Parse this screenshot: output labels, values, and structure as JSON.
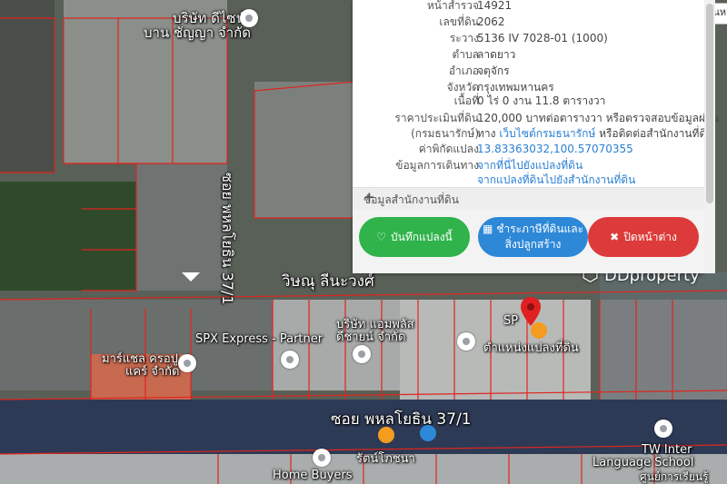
{
  "map": {
    "labels": {
      "company_top": "บริษัท ดีไซน์",
      "company_top2": "บาน ชัญญา จำกัด",
      "soi_vertical": "ซอย พหลโยธิน 37/1",
      "road_name": "วิษณุ ลีนะวงศ์",
      "spx": "SPX Express - Partner",
      "company_mid1": "บริษัท แอมพลัส",
      "company_mid2": "ดีชายน์ จำกัด",
      "marshall1": "มาร์แชล ครอปู",
      "marshall2": "แคร์ จำกัด",
      "sp": "SP",
      "near_pin": "ตำแหน่งแปลงที่ดิน",
      "soi_horizontal": "ซอย พหลโยธิน 37/1",
      "tw1": "TW Inter",
      "tw2": "Language School",
      "tw3": "ศูนย์การเรียนรู้",
      "home_buyers": "Home Buyers",
      "restaurant": "รัตน์โภชนา",
      "watermark": "DDproperty",
      "top_right_partial": "ศูนย์กา"
    }
  },
  "dropdown": {
    "value": "ค้นห"
  },
  "panel": {
    "rows": [
      {
        "key": "หน้าสำรวจ",
        "value": "14921"
      },
      {
        "key": "เลขที่ดิน",
        "value": "2062"
      },
      {
        "key": "ระวาง",
        "value": "5136 IV 7028-01 (1000)"
      },
      {
        "key": "ตำบล",
        "value": "ลาดยาว"
      },
      {
        "key": "อำเภอ",
        "value": "จตุจักร"
      },
      {
        "key": "จังหวัด",
        "value": "กรุงเทพมหานคร"
      },
      {
        "key": "เนื้อที่",
        "value": "0 ไร่ 0 งาน 11.8 ตารางวา"
      },
      {
        "key": "ราคาประเมินที่ดิน",
        "value": "120,000 บาทต่อตารางวา หรือตรวจสอบข้อมูลผ่าน"
      },
      {
        "key": "(กรมธนารักษ์)",
        "value_pre": "ทาง ",
        "value_link": "เว็บไซต์กรมธนารักษ์",
        "value_post": " หรือติดต่อสำนักงานที่ดิน"
      },
      {
        "key": "ค่าพิกัดแปลง",
        "value": "13.83363032,100.57070355"
      },
      {
        "key": "ข้อมูลการเดินทาง",
        "value": "จากที่นี่ไปยังแปลงที่ดิน"
      },
      {
        "key": "",
        "value": "จากแปลงที่ดินไปยังสำนักงานที่ดิน"
      }
    ],
    "office_label": "ข้อมูลสำนักงานที่ดิน",
    "plus": "+",
    "buttons": {
      "save": "บันทึกแปลงนี้",
      "pay_line1": "ชำระภาษีที่ดินและ",
      "pay_line2": "สิ่งปลูกสร้าง",
      "close": "ปิดหน้าต่าง"
    }
  },
  "colors": {
    "save": "#2fb34a",
    "pay": "#2d88d8",
    "close": "#dd3b3b",
    "pin": "#e02020",
    "parcel_line": "#e0251f"
  }
}
